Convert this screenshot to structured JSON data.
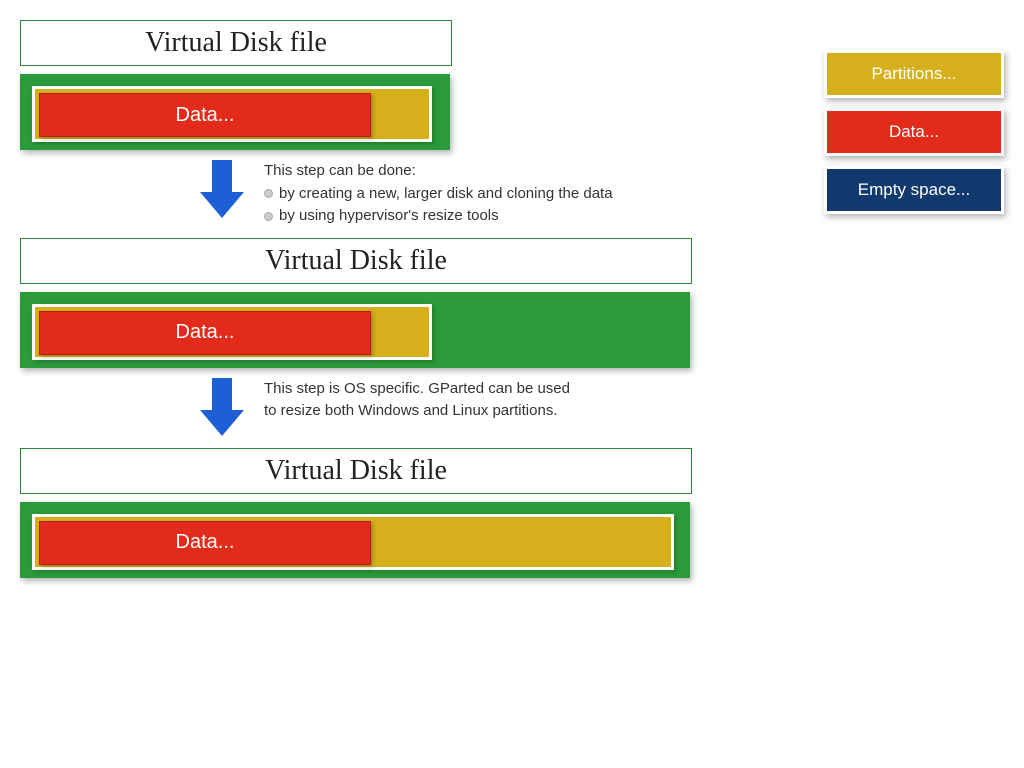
{
  "stage1": {
    "title": "Virtual Disk file",
    "disk_width": 430,
    "partition_width": 400,
    "data_width": 330,
    "data_label": "Data..."
  },
  "step1": {
    "intro": "This step can be done:",
    "bullet1": "by creating a new, larger disk and cloning the data",
    "bullet2": "by using hypervisor's resize tools"
  },
  "stage2": {
    "title": "Virtual Disk file",
    "disk_width": 670,
    "partition_width": 400,
    "data_width": 330,
    "data_label": "Data..."
  },
  "step2": {
    "line1": "This step is OS specific. GParted can be used",
    "line2": "to resize both Windows and Linux partitions."
  },
  "stage3": {
    "title": "Virtual Disk file",
    "disk_width": 670,
    "partition_width": 642,
    "data_width": 330,
    "data_label": "Data..."
  },
  "legend": {
    "partitions": "Partitions...",
    "data": "Data...",
    "empty": "Empty space..."
  },
  "colors": {
    "disk_green": "#2a9a3a",
    "partition_yellow": "#d6b01c",
    "data_red": "#e22b1a",
    "empty_blue": "#12396e",
    "arrow_blue": "#1e5fd6"
  }
}
